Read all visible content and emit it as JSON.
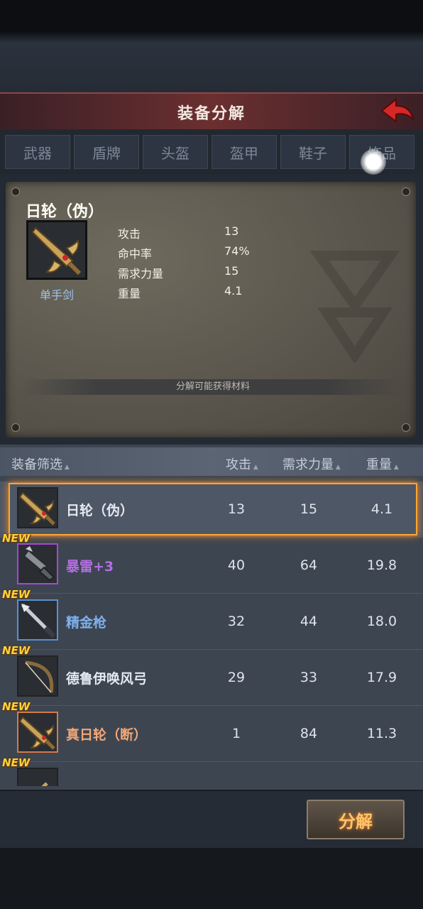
{
  "window": {
    "title": "装备分解"
  },
  "tabs": [
    {
      "label": "武器",
      "active": true
    },
    {
      "label": "盾牌",
      "active": false
    },
    {
      "label": "头盔",
      "active": false
    },
    {
      "label": "盔甲",
      "active": false
    },
    {
      "label": "鞋子",
      "active": false
    },
    {
      "label": "饰品",
      "active": false
    }
  ],
  "detail": {
    "name": "日轮（伪）",
    "type": "单手剑",
    "stats": [
      {
        "label": "攻击",
        "value": "13"
      },
      {
        "label": "命中率",
        "value": "74%"
      },
      {
        "label": "需求力量",
        "value": "15"
      },
      {
        "label": "重量",
        "value": "4.1"
      }
    ],
    "materials_label": "分解可能获得材料"
  },
  "list": {
    "headers": {
      "filter": "装备筛选",
      "attack": "攻击",
      "strength": "需求力量",
      "weight": "重量"
    },
    "new_label": "NEW",
    "rows": [
      {
        "name": "日轮（伪）",
        "attack": "13",
        "strength": "15",
        "weight": "4.1",
        "color": "#e4e8ef",
        "frame": "#222222",
        "icon": "sword-icon",
        "new": false,
        "selected": true
      },
      {
        "name": "暴雷+3",
        "attack": "40",
        "strength": "64",
        "weight": "19.8",
        "color": "#b36fe0",
        "frame": "#a548d6",
        "icon": "claw-weapon-icon",
        "new": true,
        "selected": false
      },
      {
        "name": "精金枪",
        "attack": "32",
        "strength": "44",
        "weight": "18.0",
        "color": "#7fb0ec",
        "frame": "#5a8fd0",
        "icon": "spear-icon",
        "new": true,
        "selected": false
      },
      {
        "name": "德鲁伊唤风弓",
        "attack": "29",
        "strength": "33",
        "weight": "17.9",
        "color": "#e4e8ef",
        "frame": "#222222",
        "icon": "bow-icon",
        "new": true,
        "selected": false
      },
      {
        "name": "真日轮（断）",
        "attack": "1",
        "strength": "84",
        "weight": "11.3",
        "color": "#f0a878",
        "frame": "#d57a48",
        "icon": "sword-icon",
        "new": true,
        "selected": false
      },
      {
        "name": "",
        "attack": "",
        "strength": "",
        "weight": "",
        "color": "#e4e8ef",
        "frame": "#222222",
        "icon": "partial-item-icon",
        "new": true,
        "selected": false
      }
    ]
  },
  "actions": {
    "decompose": "分解"
  }
}
